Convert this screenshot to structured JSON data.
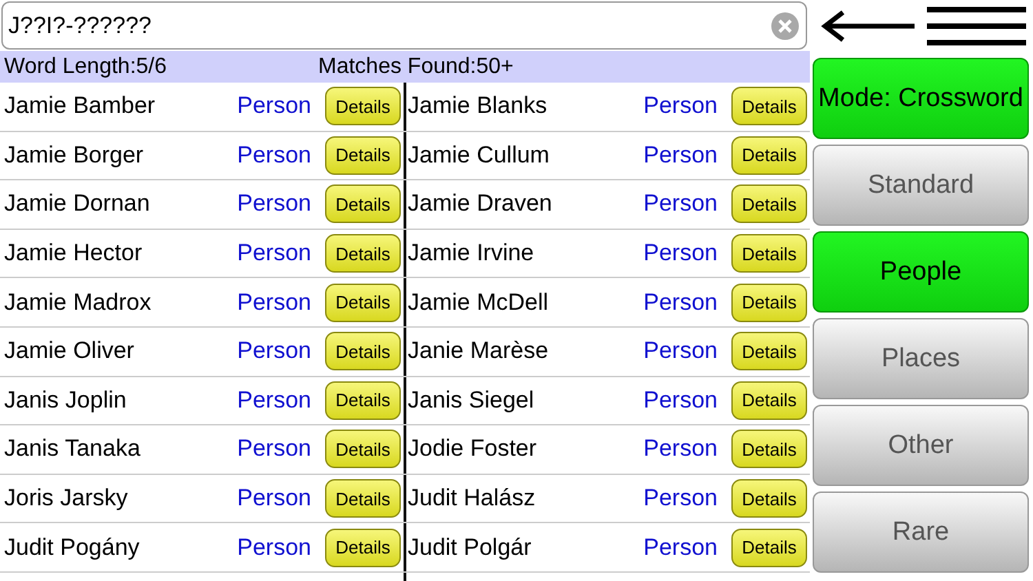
{
  "search": {
    "value": "J??I?-??????"
  },
  "summary": {
    "word_length": "Word Length:5/6",
    "matches": "Matches Found:50+"
  },
  "results": [
    {
      "name": "Jamie Bamber",
      "type": "Person",
      "button": "Details"
    },
    {
      "name": "Jamie Blanks",
      "type": "Person",
      "button": "Details"
    },
    {
      "name": "Jamie Borger",
      "type": "Person",
      "button": "Details"
    },
    {
      "name": "Jamie Cullum",
      "type": "Person",
      "button": "Details"
    },
    {
      "name": "Jamie Dornan",
      "type": "Person",
      "button": "Details"
    },
    {
      "name": "Jamie Draven",
      "type": "Person",
      "button": "Details"
    },
    {
      "name": "Jamie Hector",
      "type": "Person",
      "button": "Details"
    },
    {
      "name": "Jamie Irvine",
      "type": "Person",
      "button": "Details"
    },
    {
      "name": "Jamie Madrox",
      "type": "Person",
      "button": "Details"
    },
    {
      "name": "Jamie McDell",
      "type": "Person",
      "button": "Details"
    },
    {
      "name": "Jamie Oliver",
      "type": "Person",
      "button": "Details"
    },
    {
      "name": "Janie Marèse",
      "type": "Person",
      "button": "Details"
    },
    {
      "name": "Janis Joplin",
      "type": "Person",
      "button": "Details"
    },
    {
      "name": "Janis Siegel",
      "type": "Person",
      "button": "Details"
    },
    {
      "name": "Janis Tanaka",
      "type": "Person",
      "button": "Details"
    },
    {
      "name": "Jodie Foster",
      "type": "Person",
      "button": "Details"
    },
    {
      "name": "Joris Jarsky",
      "type": "Person",
      "button": "Details"
    },
    {
      "name": "Judit Halász",
      "type": "Person",
      "button": "Details"
    },
    {
      "name": "Judit Pogány",
      "type": "Person",
      "button": "Details"
    },
    {
      "name": "Judit Polgár",
      "type": "Person",
      "button": "Details"
    }
  ],
  "mode_button": {
    "label": "Mode: Crossword"
  },
  "filters": [
    {
      "label": "Standard",
      "selected": false
    },
    {
      "label": "People",
      "selected": true
    },
    {
      "label": "Places",
      "selected": false
    },
    {
      "label": "Other",
      "selected": false
    },
    {
      "label": "Rare",
      "selected": false
    }
  ]
}
